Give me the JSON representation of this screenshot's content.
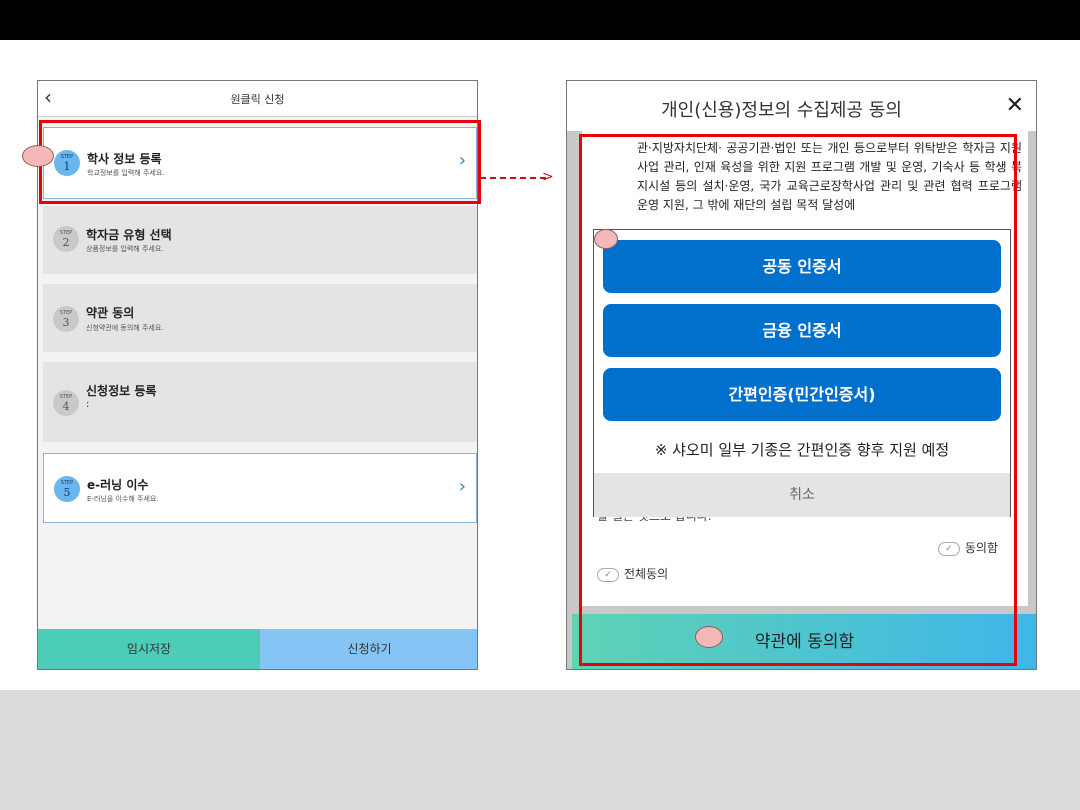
{
  "left_screen": {
    "title": "원클릭 신청",
    "back_icon": "chevron-left-icon",
    "steps": [
      {
        "step_label": "STEP",
        "number": "1",
        "title": "학사 정보 등록",
        "desc": "학교정보를 입력해 주세요.",
        "active": true
      },
      {
        "step_label": "STEP",
        "number": "2",
        "title": "학자금 유형 선택",
        "desc": "상품정보를 입력해 주세요.",
        "active": false
      },
      {
        "step_label": "STEP",
        "number": "3",
        "title": "약관 동의",
        "desc": "신청약관에 동의해 주세요.",
        "active": false
      },
      {
        "step_label": "STEP",
        "number": "4",
        "title": "신청정보 등록",
        "desc": ":",
        "active": false
      },
      {
        "step_label": "STEP",
        "number": "5",
        "title": "e-러닝 이수",
        "desc": "E-러닝을 이수해 주세요.",
        "active": true
      }
    ],
    "footer": {
      "temp_save": "임시저장",
      "apply": "신청하기"
    }
  },
  "right_screen": {
    "title": "개인(신용)정보의 수집제공 동의",
    "close_icon": "close-icon",
    "consent_text": "관·지방자치단체· 공공기관·법인 또는 개인 등으로부터 위탁받은 학자금 지원 사업 관리, 인재 육성을 위한 지원 프로그램 개발 및 운영, 기숙사 등 학생 복지시설 등의 설치·운영, 국가 교육근로장학사업 관리 및 관련 협력 프로그램 운영 지원, 그 밖에 재단의 설립 목적 달성에",
    "partial_text": "할 일은 것으로 합니다.",
    "agree_label": "동의함",
    "agree_all_label": "전체동의",
    "modal": {
      "buttons": [
        "공동 인증서",
        "금융 인증서",
        "간편인증(민간인증서)"
      ],
      "note": "※ 샤오미 일부 기종은 간편인증 향후 지원 예정",
      "cancel": "취소"
    },
    "bottom_button": "약관에 동의함"
  },
  "colors": {
    "highlight": "#e8000b",
    "auth_button": "#0070cc",
    "footer_teal": "#4dccb9",
    "footer_blue": "#85c5f5"
  }
}
